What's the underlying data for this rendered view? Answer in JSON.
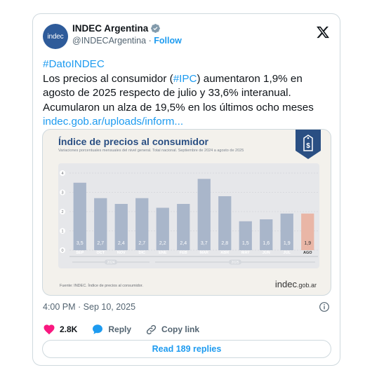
{
  "tweet": {
    "author_name": "INDEC Argentina",
    "avatar_text": "indec",
    "handle": "@INDECArgentina",
    "separator": "·",
    "follow_label": "Follow",
    "text_line1_prefix": "#DatoINDEC",
    "text_body_a": "Los precios al consumidor (",
    "text_hashtag": "#IPC",
    "text_body_b": ") aumentaron 1,9% en agosto de 2025 respecto de julio y 33,6% interanual. Acumularon un alza de 19,5% en los últimos ocho meses",
    "text_link": "indec.gob.ar/uploads/inform...",
    "timestamp": "4:00 PM · Sep 10, 2025",
    "likes": "2.8K",
    "reply_label": "Reply",
    "copy_link_label": "Copy link",
    "read_replies_label": "Read 189 replies"
  },
  "media": {
    "title": "Índice de precios al consumidor",
    "subtitle": "Variaciones porcentuales mensuales del nivel general. Total nacional. Septiembre de 2024 a agosto de 2025",
    "source": "Fuente: INDEC. Índice de precios al consumidor.",
    "brand_main": "indec",
    "brand_suffix": ".gob.ar",
    "colors": {
      "bar": "#a9b6ca",
      "highlight_bar": "#e9b6a6",
      "title": "#2a4f83"
    }
  },
  "chart_data": {
    "type": "bar",
    "categories": [
      "SEP",
      "OCT",
      "NOV",
      "DIC",
      "ENE",
      "FEB",
      "MAR",
      "ABR",
      "MAY",
      "JUN",
      "JUL",
      "AGO"
    ],
    "values": [
      3.5,
      2.7,
      2.4,
      2.7,
      2.2,
      2.4,
      3.7,
      2.8,
      1.5,
      1.6,
      1.9,
      1.9
    ],
    "value_labels": [
      "3,5",
      "2,7",
      "2,4",
      "2,7",
      "2,2",
      "2,4",
      "3,7",
      "2,8",
      "1,5",
      "1,6",
      "1,9",
      "1,9"
    ],
    "years": [
      "2024",
      "2025"
    ],
    "y_ticks": [
      "4",
      "3",
      "2",
      "1",
      "0"
    ],
    "ylim": [
      0,
      4
    ],
    "highlight_index": 11,
    "title": "Índice de precios al consumidor"
  }
}
